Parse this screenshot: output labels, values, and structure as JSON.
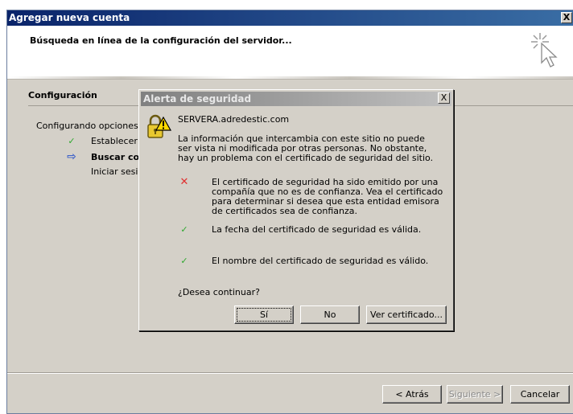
{
  "window": {
    "title": "Agregar nueva cuenta",
    "close_label": "X",
    "heading": "Búsqueda en línea de la configuración del servidor...",
    "config_label": "Configuración",
    "config_text": "Configurando opciones de",
    "steps": [
      {
        "label": "Establecer c",
        "icon": "check-icon",
        "bold": false
      },
      {
        "label": "Buscar con",
        "icon": "arrow-right-icon",
        "bold": true
      },
      {
        "label": "Iniciar sesió",
        "icon": "",
        "bold": false
      }
    ],
    "buttons": {
      "back": "< Atrás",
      "next": "Siguiente >",
      "cancel": "Cancelar"
    }
  },
  "dialog": {
    "title": "Alerta de seguridad",
    "close_label": "X",
    "host": "SERVERA.adredestic.com",
    "info": "La información que intercambia con este sitio no puede ser vista ni modificada por otras personas. No obstante, hay un problema con el certificado de seguridad del sitio.",
    "issues": [
      {
        "icon": "cross-icon",
        "text": "El certificado de seguridad ha sido emitido por una compañía que no es de confianza. Vea el certificado para determinar si desea que esta entidad emisora de certificados sea de confianza."
      },
      {
        "icon": "check-icon",
        "text": "La fecha del certificado de seguridad es válida."
      },
      {
        "icon": "check-icon",
        "text": "El nombre del certificado de seguridad es válido."
      }
    ],
    "question": "¿Desea continuar?",
    "buttons": {
      "yes": "Sí",
      "no": "No",
      "view": "Ver certificado..."
    }
  },
  "colors": {
    "title_active": "#0a246a",
    "title_inactive": "#808080",
    "face": "#d4d0c8",
    "cross": "#e03030",
    "check": "#2ea82e"
  }
}
